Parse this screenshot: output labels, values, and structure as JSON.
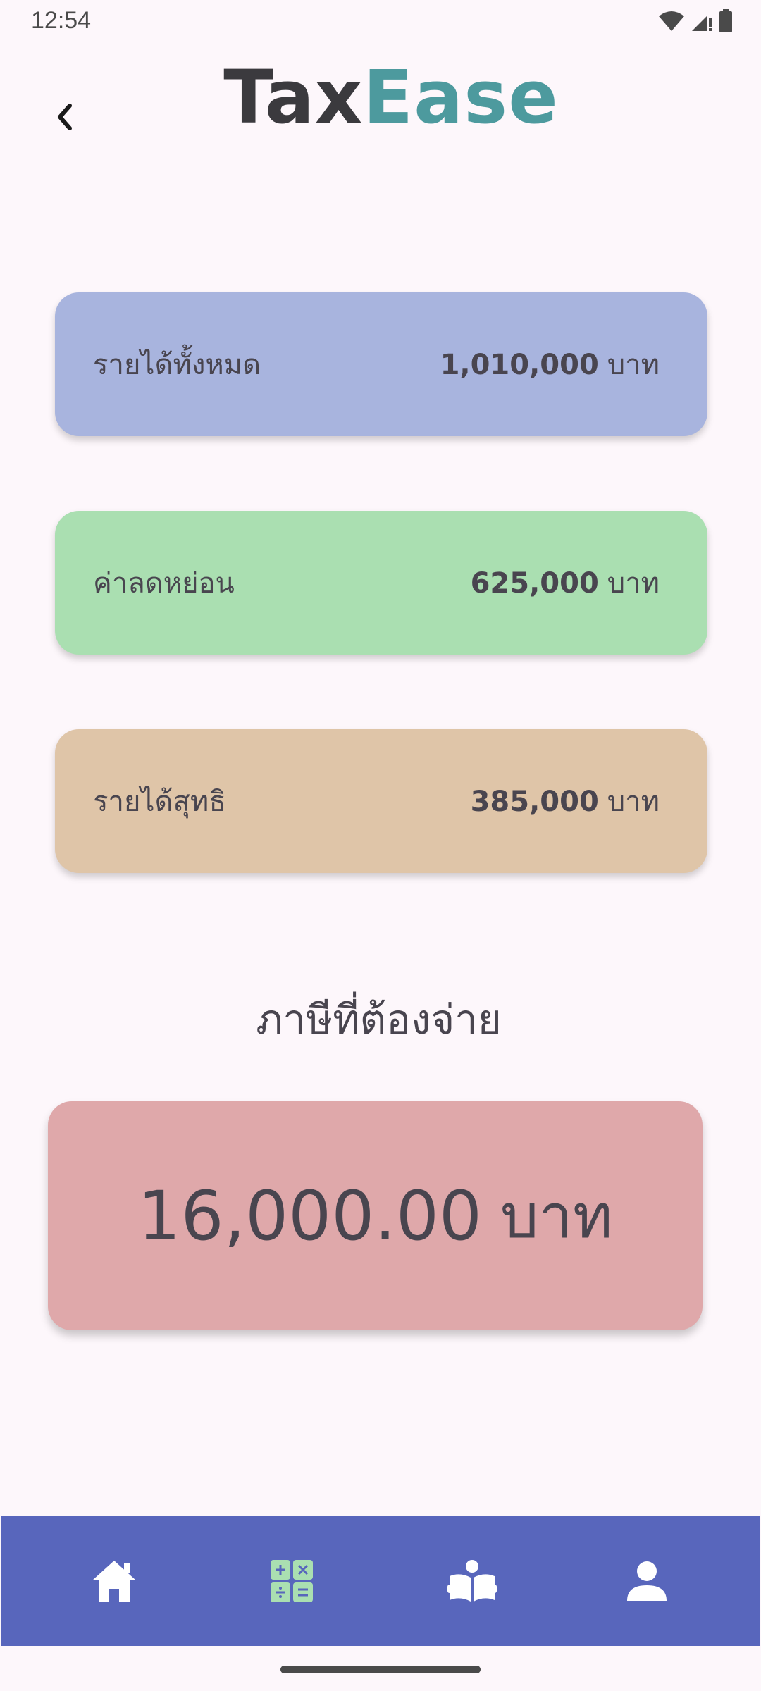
{
  "status_bar": {
    "time": "12:54",
    "icons": [
      "wifi-icon",
      "cell-signal-icon",
      "battery-icon"
    ]
  },
  "header": {
    "back_icon": "chevron-left-icon",
    "title_part_1": "Tax",
    "title_part_2": "Ease",
    "title_colors": {
      "part_1": "#3b3a3e",
      "part_2": "#4d9a9e"
    }
  },
  "summary": [
    {
      "label": "รายได้ทั้งหมด",
      "value": "1,010,000",
      "unit": "บาท",
      "color": "#a8b4de"
    },
    {
      "label": "ค่าลดหย่อน",
      "value": "625,000",
      "unit": "บาท",
      "color": "#aadfb1"
    },
    {
      "label": "รายได้สุทธิ",
      "value": "385,000",
      "unit": "บาท",
      "color": "#dfc5a8"
    }
  ],
  "tax_due": {
    "label": "ภาษีที่ต้องจ่าย",
    "amount": "16,000.00",
    "unit": "บาท",
    "color": "#dfa8aa"
  },
  "bottom_nav": {
    "background": "#5866bc",
    "items": [
      {
        "icon": "home-icon",
        "active": false
      },
      {
        "icon": "calculator-icon",
        "active": true,
        "active_color": "#aadfb1"
      },
      {
        "icon": "book-reader-icon",
        "active": false
      },
      {
        "icon": "profile-icon",
        "active": false
      }
    ]
  }
}
